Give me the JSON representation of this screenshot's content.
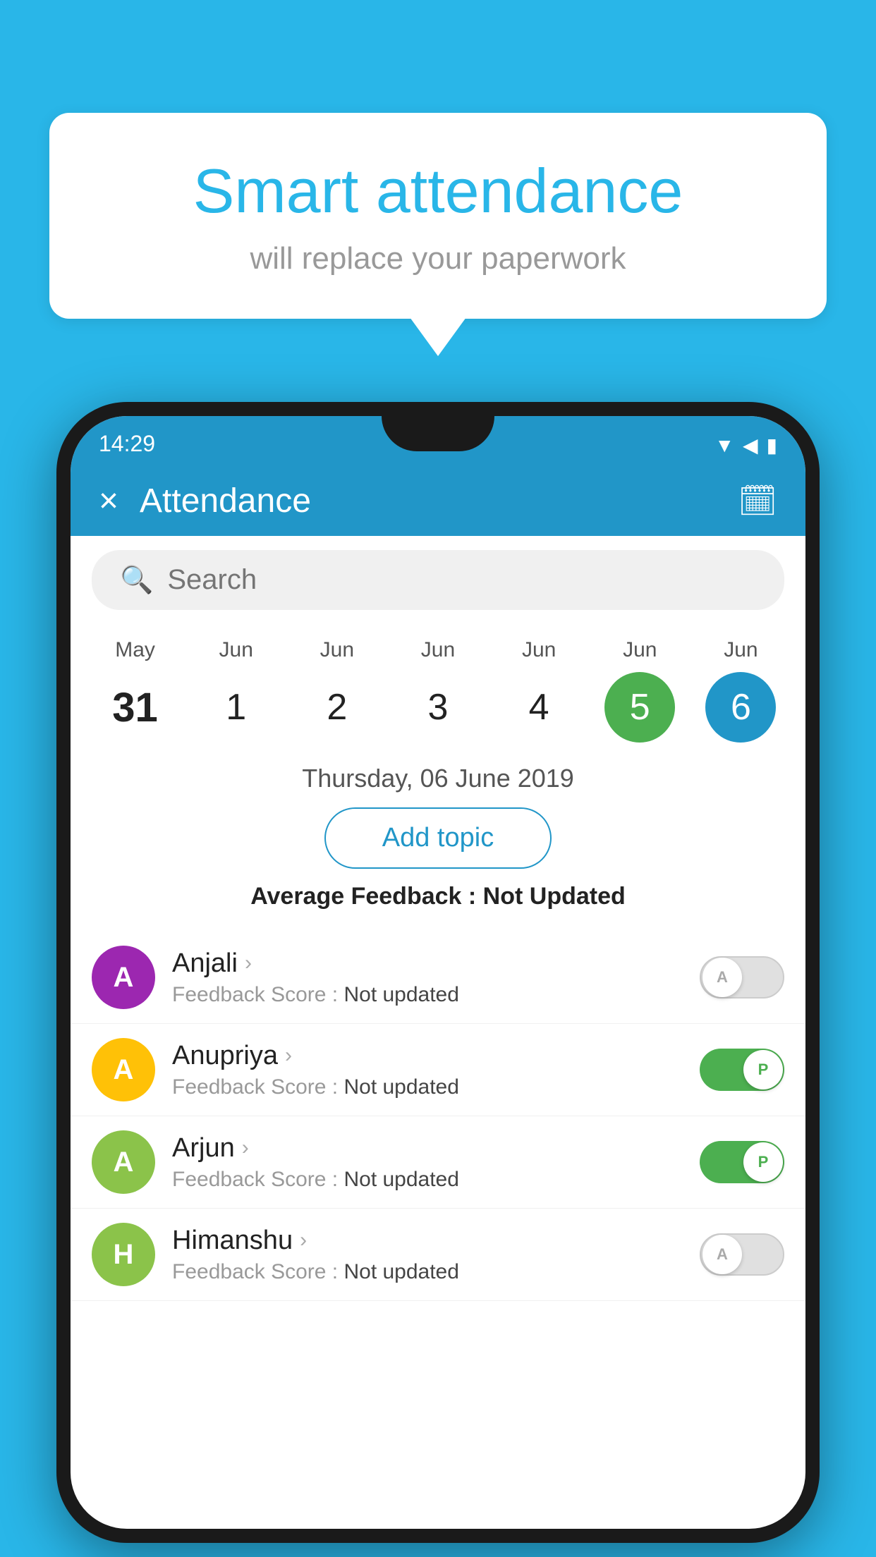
{
  "background_color": "#29B6E8",
  "bubble": {
    "title": "Smart attendance",
    "subtitle": "will replace your paperwork"
  },
  "status_bar": {
    "time": "14:29"
  },
  "header": {
    "title": "Attendance",
    "close_label": "×",
    "calendar_icon": "📅"
  },
  "search": {
    "placeholder": "Search"
  },
  "calendar": {
    "days": [
      {
        "month": "May",
        "date": "31",
        "style": "bold"
      },
      {
        "month": "Jun",
        "date": "1",
        "style": "normal"
      },
      {
        "month": "Jun",
        "date": "2",
        "style": "normal"
      },
      {
        "month": "Jun",
        "date": "3",
        "style": "normal"
      },
      {
        "month": "Jun",
        "date": "4",
        "style": "normal"
      },
      {
        "month": "Jun",
        "date": "5",
        "style": "today"
      },
      {
        "month": "Jun",
        "date": "6",
        "style": "selected"
      }
    ]
  },
  "selected_date": "Thursday, 06 June 2019",
  "add_topic_label": "Add topic",
  "avg_feedback": {
    "label": "Average Feedback : ",
    "value": "Not Updated"
  },
  "students": [
    {
      "name": "Anjali",
      "avatar_letter": "A",
      "avatar_color": "#9C27B0",
      "feedback_label": "Feedback Score : ",
      "feedback_value": "Not updated",
      "toggle": "off",
      "toggle_letter": "A"
    },
    {
      "name": "Anupriya",
      "avatar_letter": "A",
      "avatar_color": "#FFC107",
      "feedback_label": "Feedback Score : ",
      "feedback_value": "Not updated",
      "toggle": "on",
      "toggle_letter": "P"
    },
    {
      "name": "Arjun",
      "avatar_letter": "A",
      "avatar_color": "#8BC34A",
      "feedback_label": "Feedback Score : ",
      "feedback_value": "Not updated",
      "toggle": "on",
      "toggle_letter": "P"
    },
    {
      "name": "Himanshu",
      "avatar_letter": "H",
      "avatar_color": "#8BC34A",
      "feedback_label": "Feedback Score : ",
      "feedback_value": "Not updated",
      "toggle": "off",
      "toggle_letter": "A"
    }
  ]
}
